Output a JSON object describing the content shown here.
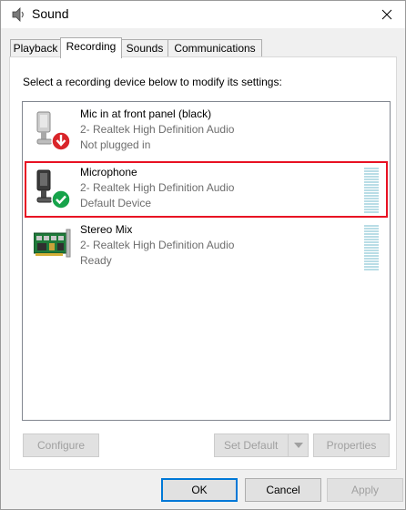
{
  "window": {
    "title": "Sound",
    "close_glyph": "✕"
  },
  "tabs": [
    {
      "label": "Playback",
      "active": false
    },
    {
      "label": "Recording",
      "active": true
    },
    {
      "label": "Sounds",
      "active": false
    },
    {
      "label": "Communications",
      "active": false
    }
  ],
  "panel": {
    "instruction": "Select a recording device below to modify its settings:"
  },
  "devices": [
    {
      "name": "Mic in at front panel (black)",
      "driver": "2- Realtek High Definition Audio",
      "status": "Not plugged in",
      "icon": "microphone-unplugged-icon",
      "selected": false
    },
    {
      "name": "Microphone",
      "driver": "2- Realtek High Definition Audio",
      "status": "Default Device",
      "icon": "microphone-default-icon",
      "selected": true,
      "level_meter": true
    },
    {
      "name": "Stereo Mix",
      "driver": "2- Realtek High Definition Audio",
      "status": "Ready",
      "icon": "sound-card-icon",
      "selected": false,
      "level_meter": true
    }
  ],
  "buttons": {
    "configure": "Configure",
    "set_default": "Set Default",
    "properties": "Properties",
    "ok": "OK",
    "cancel": "Cancel",
    "apply": "Apply"
  },
  "colors": {
    "selection_border": "#e81123",
    "default_badge": "#16a34a",
    "unplugged_badge": "#d9252a",
    "level_meter": "#b9dde6",
    "ok_focus": "#0078d7"
  }
}
